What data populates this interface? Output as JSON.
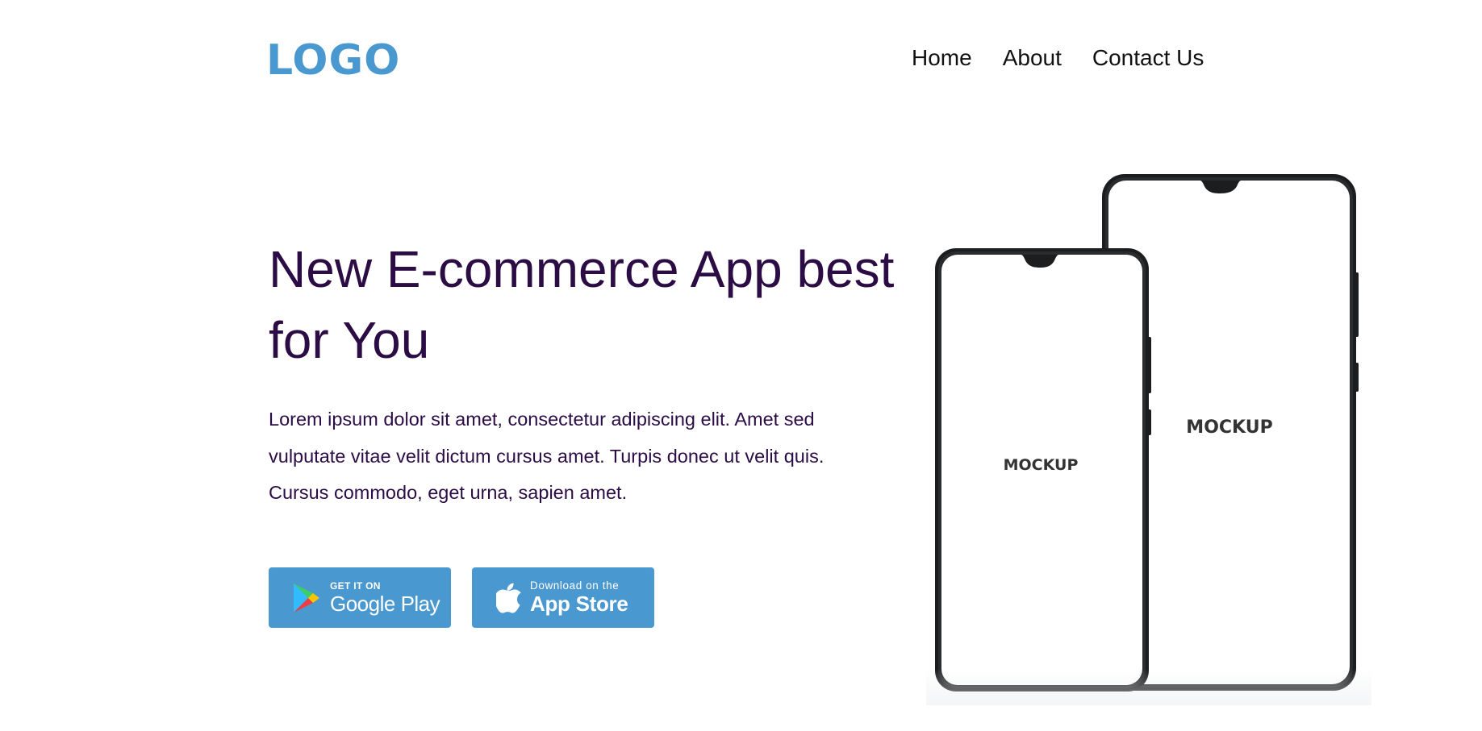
{
  "header": {
    "logo": "LOGO",
    "nav": {
      "home": "Home",
      "about": "About",
      "contact": "Contact Us"
    }
  },
  "hero": {
    "headline": "New E-commerce App best for You",
    "description": "Lorem ipsum dolor sit amet, consectetur adipiscing elit. Amet sed vulputate vitae velit dictum cursus amet. Turpis donec ut velit quis. Cursus commodo, eget urna, sapien amet."
  },
  "buttons": {
    "google_play": {
      "small": "GET IT ON",
      "big": "Google Play"
    },
    "app_store": {
      "small": "Download on the",
      "big": "App Store"
    }
  },
  "mockups": {
    "left_screen_label": "MOCKUP",
    "right_screen_label": "MOCKUP"
  },
  "colors": {
    "brand_blue": "#4a98d0",
    "headline": "#2b0c45",
    "nav_text": "#111111",
    "phone_frame": "#1b1d1f",
    "background": "#ffffff"
  },
  "icons": [
    "google-play-icon",
    "apple-icon"
  ]
}
